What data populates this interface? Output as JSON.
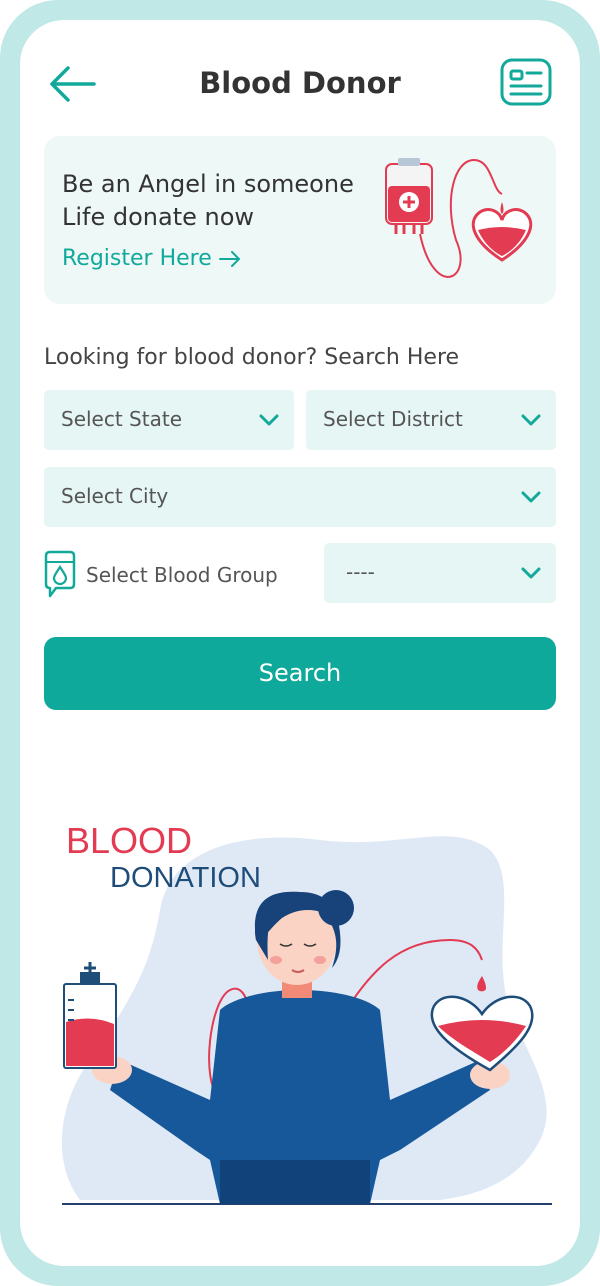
{
  "header": {
    "title": "Blood Donor",
    "back_icon": "arrow-left-icon",
    "card_icon": "id-card-icon"
  },
  "banner": {
    "line1": "Be an Angel in someone",
    "line2": "Life donate now",
    "register_label": "Register Here"
  },
  "search": {
    "label": "Looking for blood donor? Search Here",
    "state_placeholder": "Select State",
    "district_placeholder": "Select District",
    "city_placeholder": "Select City",
    "blood_group_label": "Select Blood Group",
    "blood_group_value": "----",
    "search_button": "Search"
  },
  "illustration": {
    "word1": "BLOOD",
    "word2": "DONATION"
  },
  "colors": {
    "accent": "#0ea99a",
    "frame": "#bfe8e6",
    "field": "#e6f6f5",
    "blood_red": "#e23b52",
    "navy": "#1f4d7a"
  }
}
